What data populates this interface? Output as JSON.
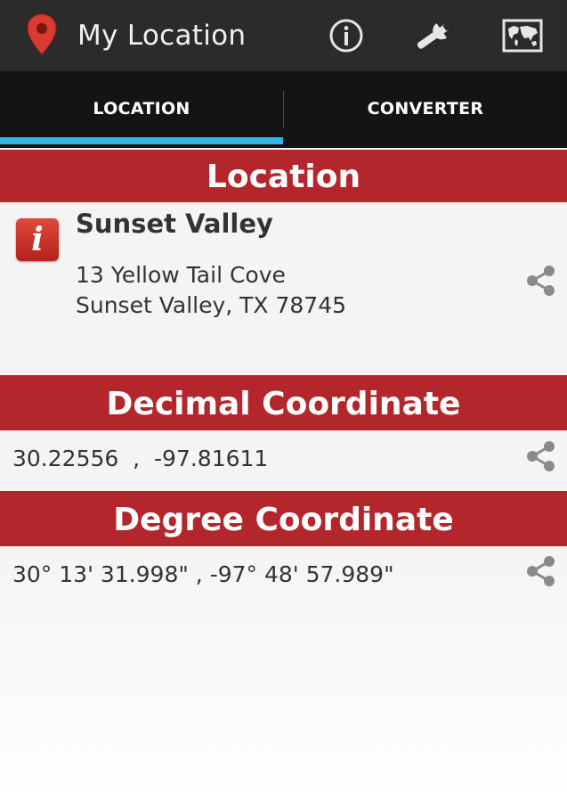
{
  "app": {
    "title": "My Location"
  },
  "action_bar": {
    "icons": [
      "map-pin-icon",
      "info-icon",
      "wrench-icon",
      "world-map-icon"
    ]
  },
  "tabs": [
    {
      "label": "LOCATION",
      "selected": true
    },
    {
      "label": "CONVERTER",
      "selected": false
    }
  ],
  "sections": {
    "location": {
      "header": "Location",
      "name": "Sunset Valley",
      "address_line1": "13 Yellow Tail Cove",
      "address_line2": "Sunset Valley, TX 78745"
    },
    "decimal": {
      "header": "Decimal Coordinate",
      "value": "30.22556  ,  -97.81611"
    },
    "degree": {
      "header": "Degree Coordinate",
      "value": "30° 13' 31.998\" , -97° 48' 57.989\""
    }
  },
  "colors": {
    "action_bar": "#2b2b2b",
    "tab_bar": "#141414",
    "tab_indicator": "#33b5e5",
    "section_header": "#b3262b",
    "pin": "#d93a32"
  }
}
